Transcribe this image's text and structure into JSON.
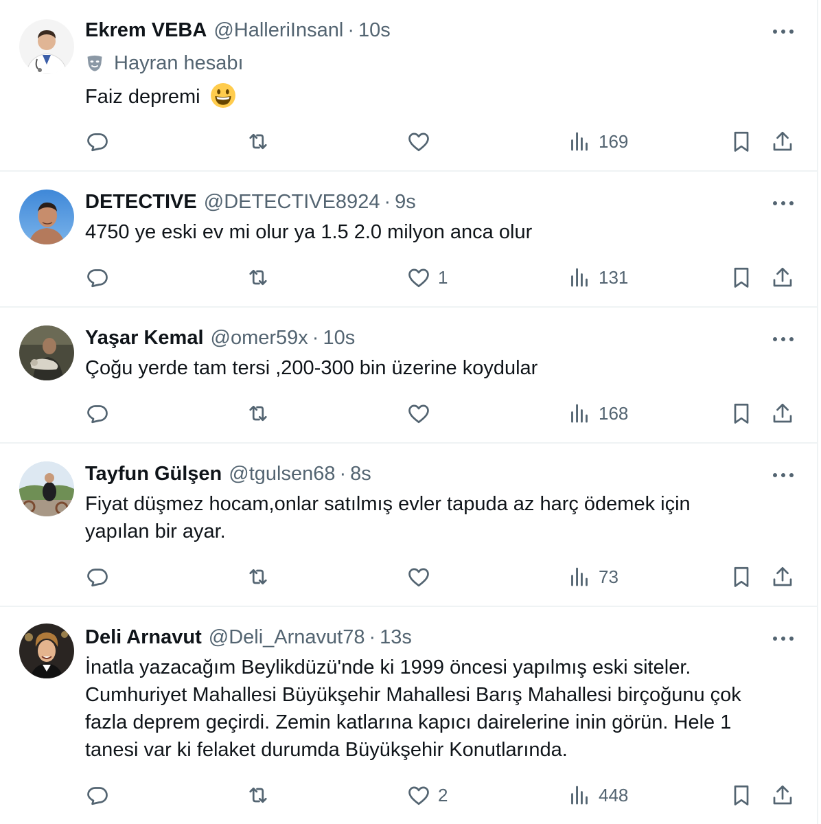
{
  "tweets": [
    {
      "name": "Ekrem VEBA",
      "handle": "@HalleriInsanl",
      "dot": "·",
      "time": "10s",
      "badge": "Hayran hesabı",
      "text": "Faiz depremi",
      "emoji": "grinning-face",
      "replies": "",
      "retweets": "",
      "likes": "",
      "views": "169"
    },
    {
      "name": "DETECTIVE",
      "handle": "@DETECTIVE8924",
      "dot": "·",
      "time": "9s",
      "text": "4750 ye eski ev mi olur ya 1.5 2.0 milyon anca olur",
      "replies": "",
      "retweets": "",
      "likes": "1",
      "views": "131"
    },
    {
      "name": "Yaşar Kemal",
      "handle": "@omer59x",
      "dot": "·",
      "time": "10s",
      "text": "Çoğu yerde tam tersi ,200-300 bin üzerine koydular",
      "replies": "",
      "retweets": "",
      "likes": "",
      "views": "168"
    },
    {
      "name": "Tayfun Gülşen",
      "handle": "@tgulsen68",
      "dot": "·",
      "time": "8s",
      "text": "Fiyat düşmez hocam,onlar satılmış evler tapuda az harç ödemek için yapılan bir ayar.",
      "replies": "",
      "retweets": "",
      "likes": "",
      "views": "73"
    },
    {
      "name": "Deli Arnavut",
      "handle": "@Deli_Arnavut78",
      "dot": "·",
      "time": "13s",
      "text": "İnatla yazacağım Beylikdüzü'nde ki 1999 öncesi yapılmış eski siteler. Cumhuriyet Mahallesi Büyükşehir Mahallesi Barış Mahallesi birçoğunu çok fazla deprem geçirdi. Zemin katlarına kapıcı dairelerine inin görün. Hele 1 tanesi var ki felaket durumda Büyükşehir Konutlarında.",
      "replies": "",
      "retweets": "",
      "likes": "2",
      "views": "448"
    }
  ],
  "icons": {
    "reply": "reply-icon",
    "retweet": "retweet-icon",
    "like": "like-icon",
    "views": "views-icon",
    "bookmark": "bookmark-icon",
    "share": "share-icon",
    "more": "more-icon",
    "badge": "theater-mask-icon"
  },
  "colors": {
    "text": "#0f1419",
    "secondary": "#536471",
    "divider": "#eff3f4"
  }
}
